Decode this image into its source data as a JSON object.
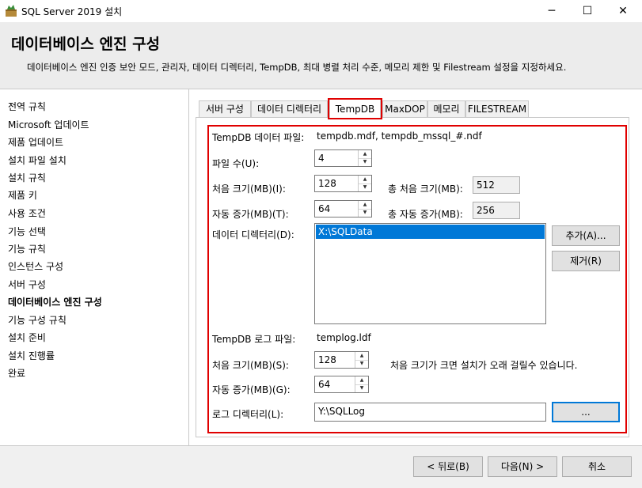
{
  "window": {
    "title": "SQL Server 2019 설치",
    "minimize_glyph": "─",
    "maximize_glyph": "☐",
    "close_glyph": "✕"
  },
  "header": {
    "title": "데이터베이스 엔진 구성",
    "description": "데이터베이스 엔진 인증 보안 모드, 관리자, 데이터 디렉터리, TempDB, 최대 병렬 처리 수준, 메모리 제한 및 Filestream 설정을 지정하세요."
  },
  "nav": {
    "items": [
      {
        "label": "전역 규칙"
      },
      {
        "label": "Microsoft 업데이트"
      },
      {
        "label": "제품 업데이트"
      },
      {
        "label": "설치 파일 설치"
      },
      {
        "label": "설치 규칙"
      },
      {
        "label": "제품 키"
      },
      {
        "label": "사용 조건"
      },
      {
        "label": "기능 선택"
      },
      {
        "label": "기능 규칙"
      },
      {
        "label": "인스턴스 구성"
      },
      {
        "label": "서버 구성"
      },
      {
        "label": "데이터베이스 엔진 구성"
      },
      {
        "label": "기능 구성 규칙"
      },
      {
        "label": "설치 준비"
      },
      {
        "label": "설치 진행률"
      },
      {
        "label": "완료"
      }
    ],
    "active": "데이터베이스 엔진 구성"
  },
  "tabs": [
    {
      "label": "서버 구성"
    },
    {
      "label": "데이터 디렉터리"
    },
    {
      "label": "TempDB"
    },
    {
      "label": "MaxDOP"
    },
    {
      "label": "메모리"
    },
    {
      "label": "FILESTREAM"
    }
  ],
  "selected_tab": "TempDB",
  "tempdb": {
    "data_files_label": "TempDB 데이터 파일:",
    "data_files_value": "tempdb.mdf, tempdb_mssql_#.ndf",
    "file_count_label": "파일 수(U):",
    "file_count": "4",
    "initial_size_label": "처음 크기(MB)(I):",
    "initial_size": "128",
    "total_initial_label": "총 처음 크기(MB):",
    "total_initial": "512",
    "autogrowth_label": "자동 증가(MB)(T):",
    "autogrowth": "64",
    "total_autogrowth_label": "총 자동 증가(MB):",
    "total_autogrowth": "256",
    "data_dir_label": "데이터 디렉터리(D):",
    "data_dirs": [
      "X:\\SQLData"
    ],
    "add_button": "추가(A)...",
    "remove_button": "제거(R)",
    "log_file_label": "TempDB 로그 파일:",
    "log_file_value": "templog.ldf",
    "log_initial_label": "처음 크기(MB)(S):",
    "log_initial": "128",
    "log_warning": "처음 크기가 크면 설치가 오래 걸릴수 있습니다.",
    "log_autogrowth_label": "자동 증가(MB)(G):",
    "log_autogrowth": "64",
    "log_dir_label": "로그 디렉터리(L):",
    "log_dir": "Y:\\SQLLog",
    "browse_button": "..."
  },
  "footer": {
    "back_button": "< 뒤로(B)",
    "next_button": "다음(N) >",
    "cancel_button": "취소"
  },
  "colors": {
    "highlight_border": "#e00000",
    "selection": "#0078d7"
  }
}
